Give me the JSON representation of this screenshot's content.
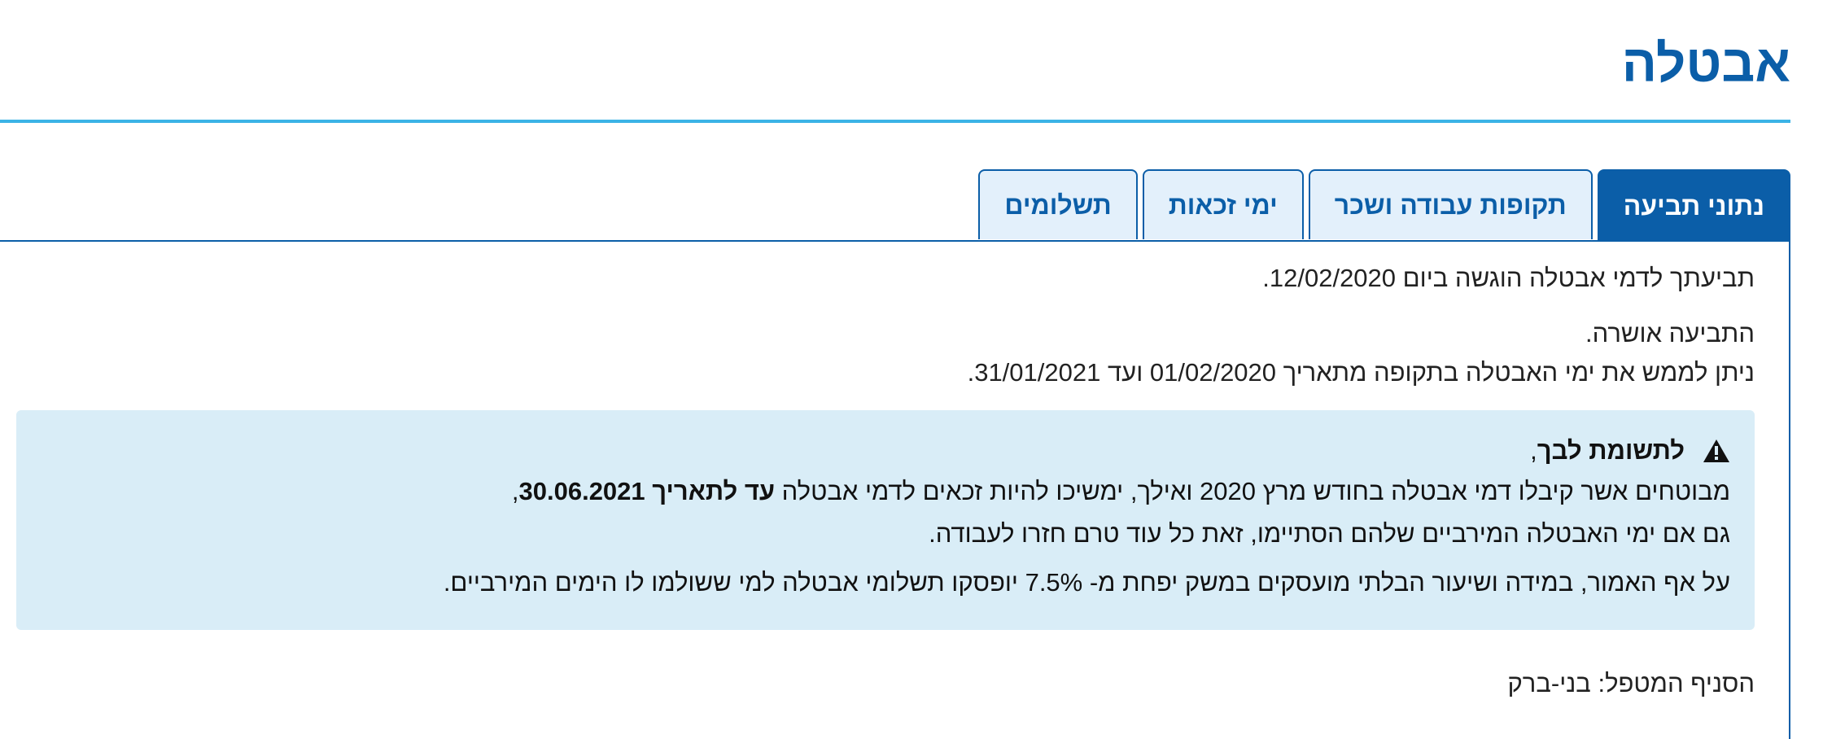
{
  "page": {
    "title": "אבטלה"
  },
  "tabs": [
    {
      "label": "נתוני תביעה",
      "active": true
    },
    {
      "label": "תקופות עבודה ושכר",
      "active": false
    },
    {
      "label": "ימי זכאות",
      "active": false
    },
    {
      "label": "תשלומים",
      "active": false
    }
  ],
  "claim": {
    "submitted": "תביעתך לדמי אבטלה הוגשה ביום 12/02/2020.",
    "approved": "התביעה אושרה.",
    "period": "ניתן לממש את ימי האבטלה בתקופה מתאריך 01/02/2020 ועד 31/01/2021."
  },
  "notice": {
    "icon": "warning-icon",
    "heading_bold": "לתשומת לבך",
    "heading_rest": ",",
    "line1_start": "מבוטחים אשר קיבלו דמי אבטלה בחודש מרץ 2020 ואילך, ימשיכו להיות זכאים לדמי אבטלה ",
    "line1_bold": "עד לתאריך 30.06.2021",
    "line1_end": ",",
    "line2": "גם אם ימי האבטלה המירביים שלהם הסתיימו, זאת כל עוד טרם חזרו לעבודה.",
    "line3": "על אף האמור, במידה ושיעור הבלתי מועסקים במשק יפחת מ- 7.5% יופסקו תשלומי אבטלה למי ששולמו לו הימים המירביים."
  },
  "branch": {
    "text": "הסניף המטפל: בני-ברק"
  },
  "colors": {
    "brand": "#0b5ea8",
    "rule": "#3bb3e6",
    "notice_bg": "#d9edf7"
  }
}
